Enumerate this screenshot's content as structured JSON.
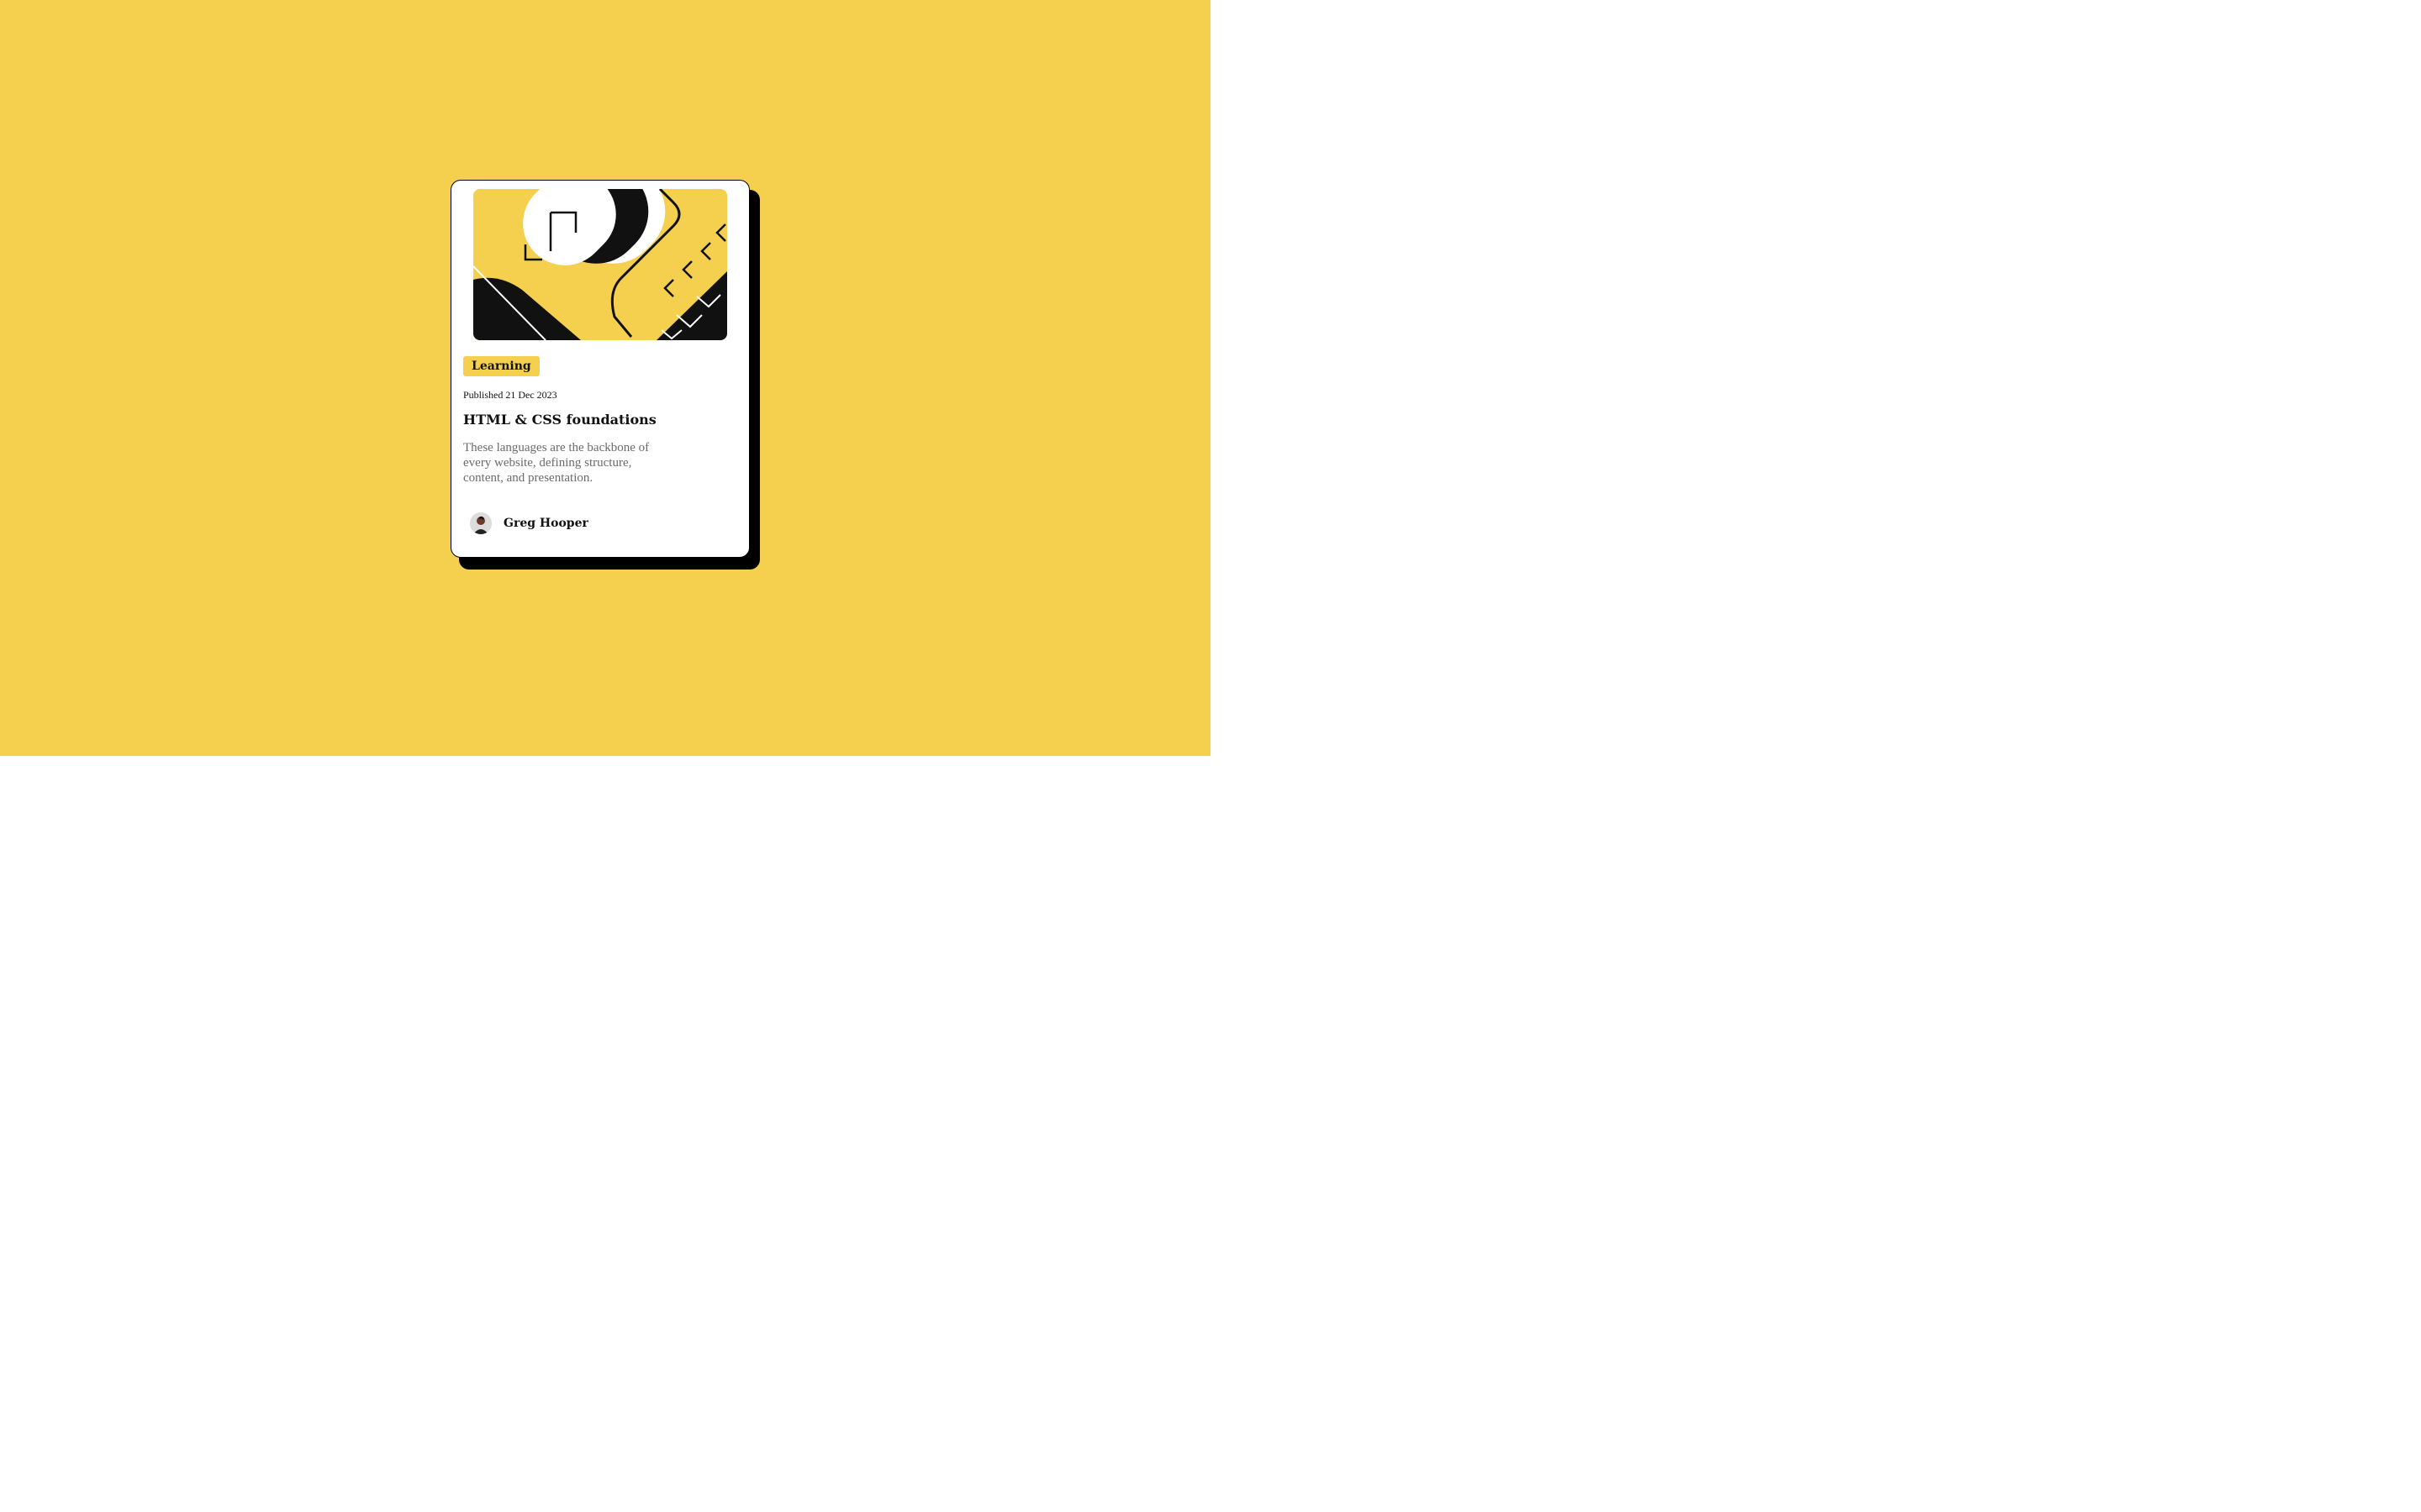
{
  "card": {
    "tag": "Learning",
    "published": "Published 21 Dec 2023",
    "title": "HTML & CSS foundations",
    "description": "These languages are the backbone of every website, defining structure, content, and presentation.",
    "author": {
      "name": "Greg Hooper",
      "avatar_icon": "avatar-portrait"
    },
    "illustration_icon": "abstract-illustration"
  },
  "colors": {
    "background": "#f4d04e",
    "card": "#ffffff",
    "ink": "#111111",
    "muted_text": "#6b6b6b"
  }
}
